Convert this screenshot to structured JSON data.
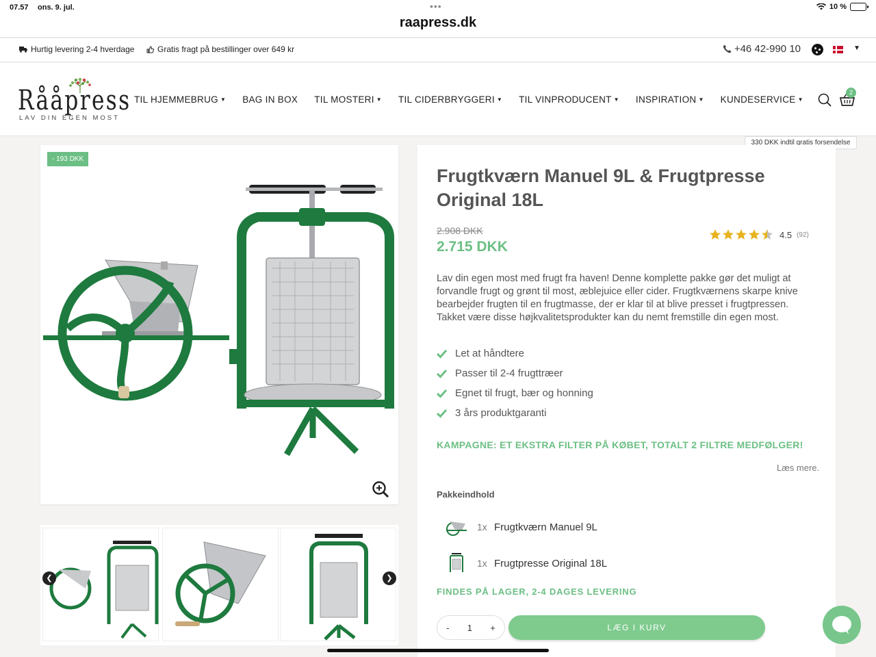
{
  "status_bar": {
    "time": "07.57",
    "date": "ons. 9. jul.",
    "battery": "10 %"
  },
  "browser": {
    "url": "raapress.dk"
  },
  "info_bar": {
    "delivery": "Hurtig levering 2-4 hverdage",
    "free_shipping": "Gratis fragt på bestillinger over 649 kr",
    "phone": "+46 42-990 10"
  },
  "logo": {
    "name": "Rååpress",
    "tagline": "LAV DIN EGEN MOST"
  },
  "nav": {
    "items": [
      {
        "label": "TIL HJEMMEBRUG",
        "dropdown": true
      },
      {
        "label": "BAG IN BOX",
        "dropdown": false
      },
      {
        "label": "TIL MOSTERI",
        "dropdown": true
      },
      {
        "label": "TIL CIDERBRYGGERI",
        "dropdown": true
      },
      {
        "label": "TIL VINPRODUCENT",
        "dropdown": true
      },
      {
        "label": "INSPIRATION",
        "dropdown": true
      },
      {
        "label": "KUNDESERVICE",
        "dropdown": true
      }
    ],
    "cart_count": "2",
    "free_shipping_tip": "330 DKK indtil gratis forsendelse"
  },
  "product": {
    "discount_badge": "- 193 DKK",
    "title": "Frugtkværn Manuel 9L & Frugtpresse Original 18L",
    "old_price": "2.908 DKK",
    "price": "2.715 DKK",
    "rating": "4.5",
    "rating_value": 4.5,
    "rating_count": "(92)",
    "description": "Lav din egen most med frugt fra haven! Denne komplette pakke gør det muligt at forvandle frugt og grønt til most, æblejuice eller cider. Frugtkværnens skarpe knive bearbejder frugten til en frugtmasse, der er klar til at blive presset i frugtpressen. Takket være disse højkvalitetsprodukter kan du nemt fremstille din egen most.",
    "features": [
      "Let at håndtere",
      "Passer til 2-4 frugttræer",
      "Egnet til frugt, bær og honning",
      "3 års produktgaranti"
    ],
    "campaign": "KAMPAGNE: ET EKSTRA FILTER PÅ KØBET, TOTALT 2 FILTRE MEDFØLGER!",
    "read_more": "Læs mere.",
    "package_heading": "Pakkeindhold",
    "package": [
      {
        "qty": "1x",
        "name": "Frugtkværn Manuel 9L"
      },
      {
        "qty": "1x",
        "name": "Frugtpresse Original 18L"
      }
    ],
    "stock": "FINDES PÅ LAGER, 2-4 DAGES LEVERING",
    "quantity": "1",
    "minus": "-",
    "plus": "+",
    "add_to_cart": "LÆG I KURV"
  },
  "colors": {
    "accent": "#6cbf84",
    "press_green": "#1e7a3e"
  }
}
